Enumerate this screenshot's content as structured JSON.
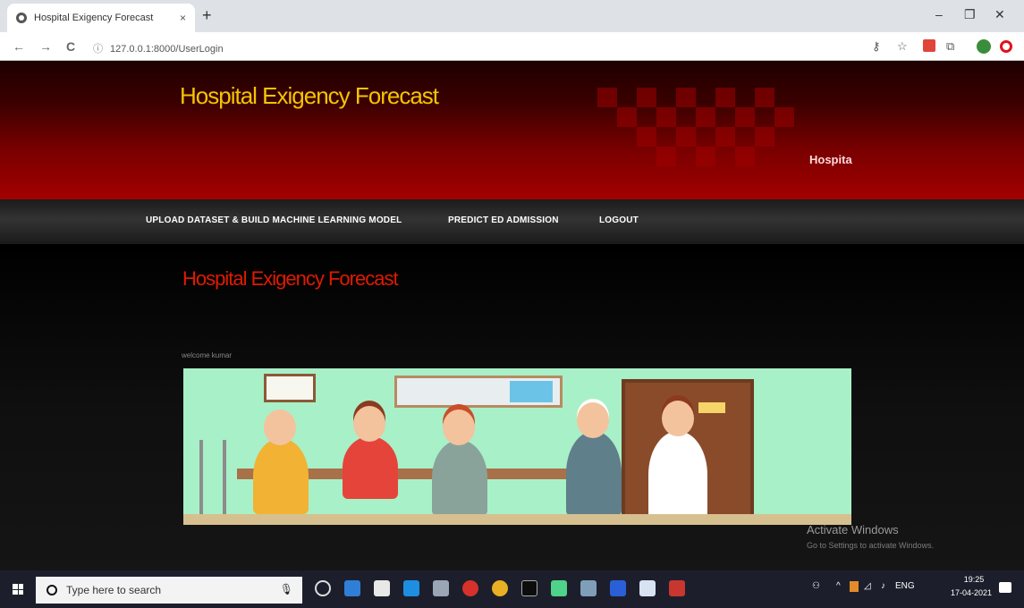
{
  "browser": {
    "tab_title": "Hospital Exigency Forecast",
    "tab_close": "×",
    "new_tab": "+",
    "minimize": "–",
    "restore": "❐",
    "close": "✕",
    "url": "127.0.0.1:8000/UserLogin",
    "back": "←",
    "forward": "→",
    "reload": "C",
    "info": "ⓘ"
  },
  "header": {
    "site_title": "Hospital Exigency Forecast",
    "side_text": "Hospita"
  },
  "nav": {
    "items": [
      {
        "label": "UPLOAD DATASET & BUILD MACHINE LEARNING MODEL"
      },
      {
        "label": "PREDICT ED ADMISSION"
      },
      {
        "label": "LOGOUT"
      }
    ]
  },
  "main": {
    "title": "Hospital Exigency Forecast",
    "welcome": "welcome kumar"
  },
  "watermark": {
    "line1": "Activate Windows",
    "line2": "Go to Settings to activate Windows."
  },
  "taskbar": {
    "search_placeholder": "Type here to search",
    "time": "19:25",
    "date": "17-04-2021",
    "tray_lang": "ENG"
  }
}
